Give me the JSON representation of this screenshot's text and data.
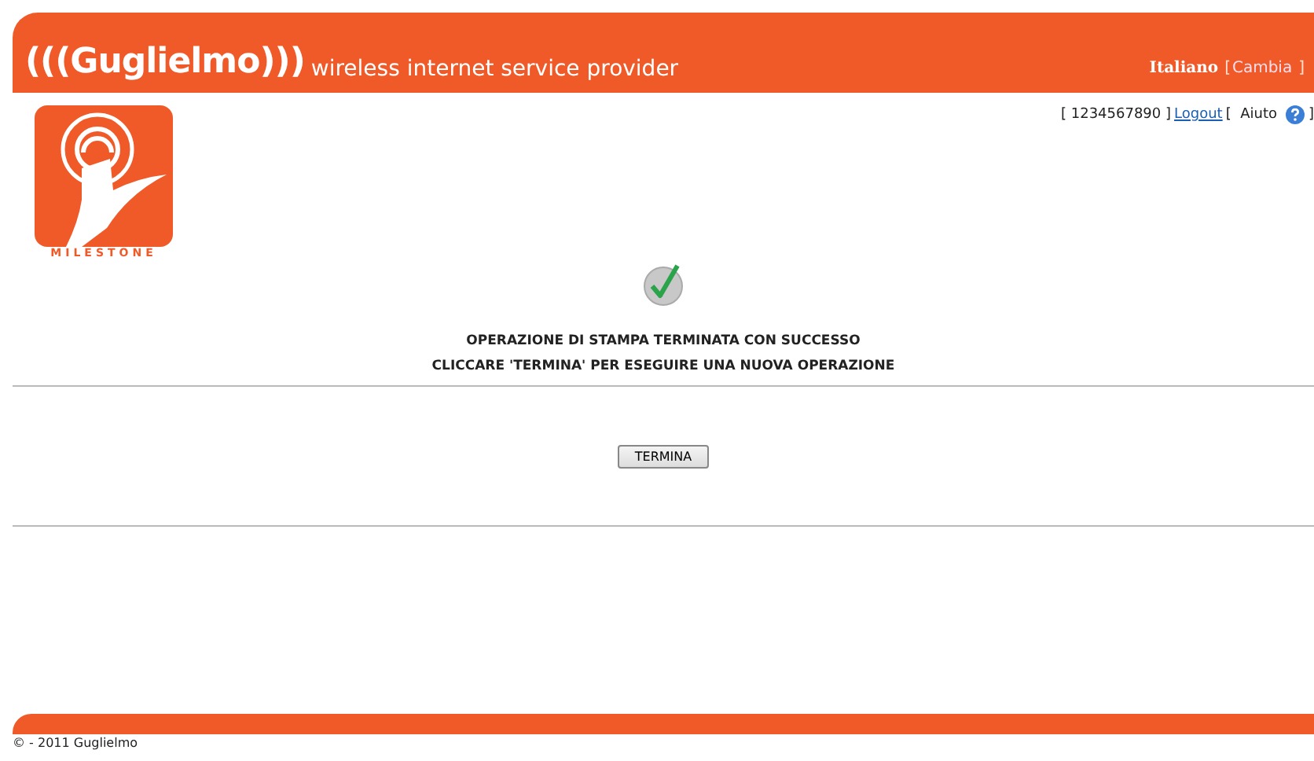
{
  "header": {
    "brand": "(((Guglielmo)))",
    "tagline": "wireless internet service provider",
    "language": "Italiano",
    "language_link": "Cambia",
    "bracket_open": "[",
    "bracket_close": "]"
  },
  "logo": {
    "caption": "MILESTONE"
  },
  "user_bar": {
    "user_id": "[ 1234567890 ]",
    "logout_link": "Logout",
    "help": "[  Aiuto",
    "help_close": "]"
  },
  "message": {
    "lines": [
      "OPERAZIONE DI STAMPA TERMINATA CON SUCCESSO",
      "CLICCARE 'TERMINA' PER ESEGUIRE UNA NUOVA OPERAZIONE"
    ]
  },
  "buttons": [
    "TERMINA"
  ],
  "footer": {
    "copyright": "© - 2011 Guglielmo"
  }
}
